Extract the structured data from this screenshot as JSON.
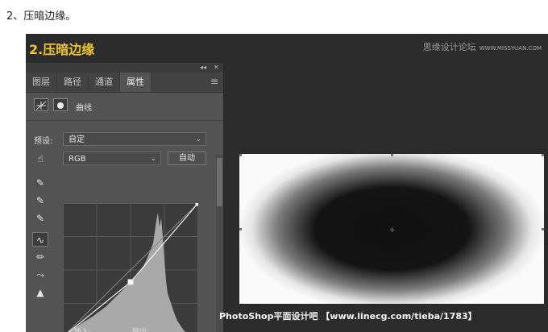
{
  "caption": "2、压暗边缘。",
  "step_title": "2.压暗边缘",
  "watermark_top": "思缘设计论坛",
  "watermark_top_url": "WWW.MISSYUAN.COM",
  "panel": {
    "topbar_collapse": "◂◂",
    "topbar_close": "✕",
    "tabs": [
      "图层",
      "路径",
      "通道",
      "属性"
    ],
    "active_tab": "属性",
    "menu_icon": "menu-icon",
    "header_label": "曲线",
    "preset_label": "预设:",
    "preset_value": "自定",
    "channel_value": "RGB",
    "auto_button": "自动",
    "input_label": "输入:",
    "output_label": "输出:"
  },
  "tools": [
    "target-adjust-icon",
    "black-point-eyedropper-icon",
    "gray-point-eyedropper-icon",
    "white-point-eyedropper-icon",
    "curve-point-icon",
    "pencil-icon",
    "smooth-icon",
    "clipping-warning-icon"
  ],
  "curve": {
    "points": [
      [
        0,
        0
      ],
      [
        50,
        41
      ],
      [
        100,
        100
      ]
    ]
  },
  "colors": {
    "step_title": "#f2c531",
    "panel_bg": "#535353",
    "stage_bg": "#2b2b2b"
  },
  "watermark_bottom": "PhotoShop平面设计吧 【www.linecg.com/tieba/1783】"
}
